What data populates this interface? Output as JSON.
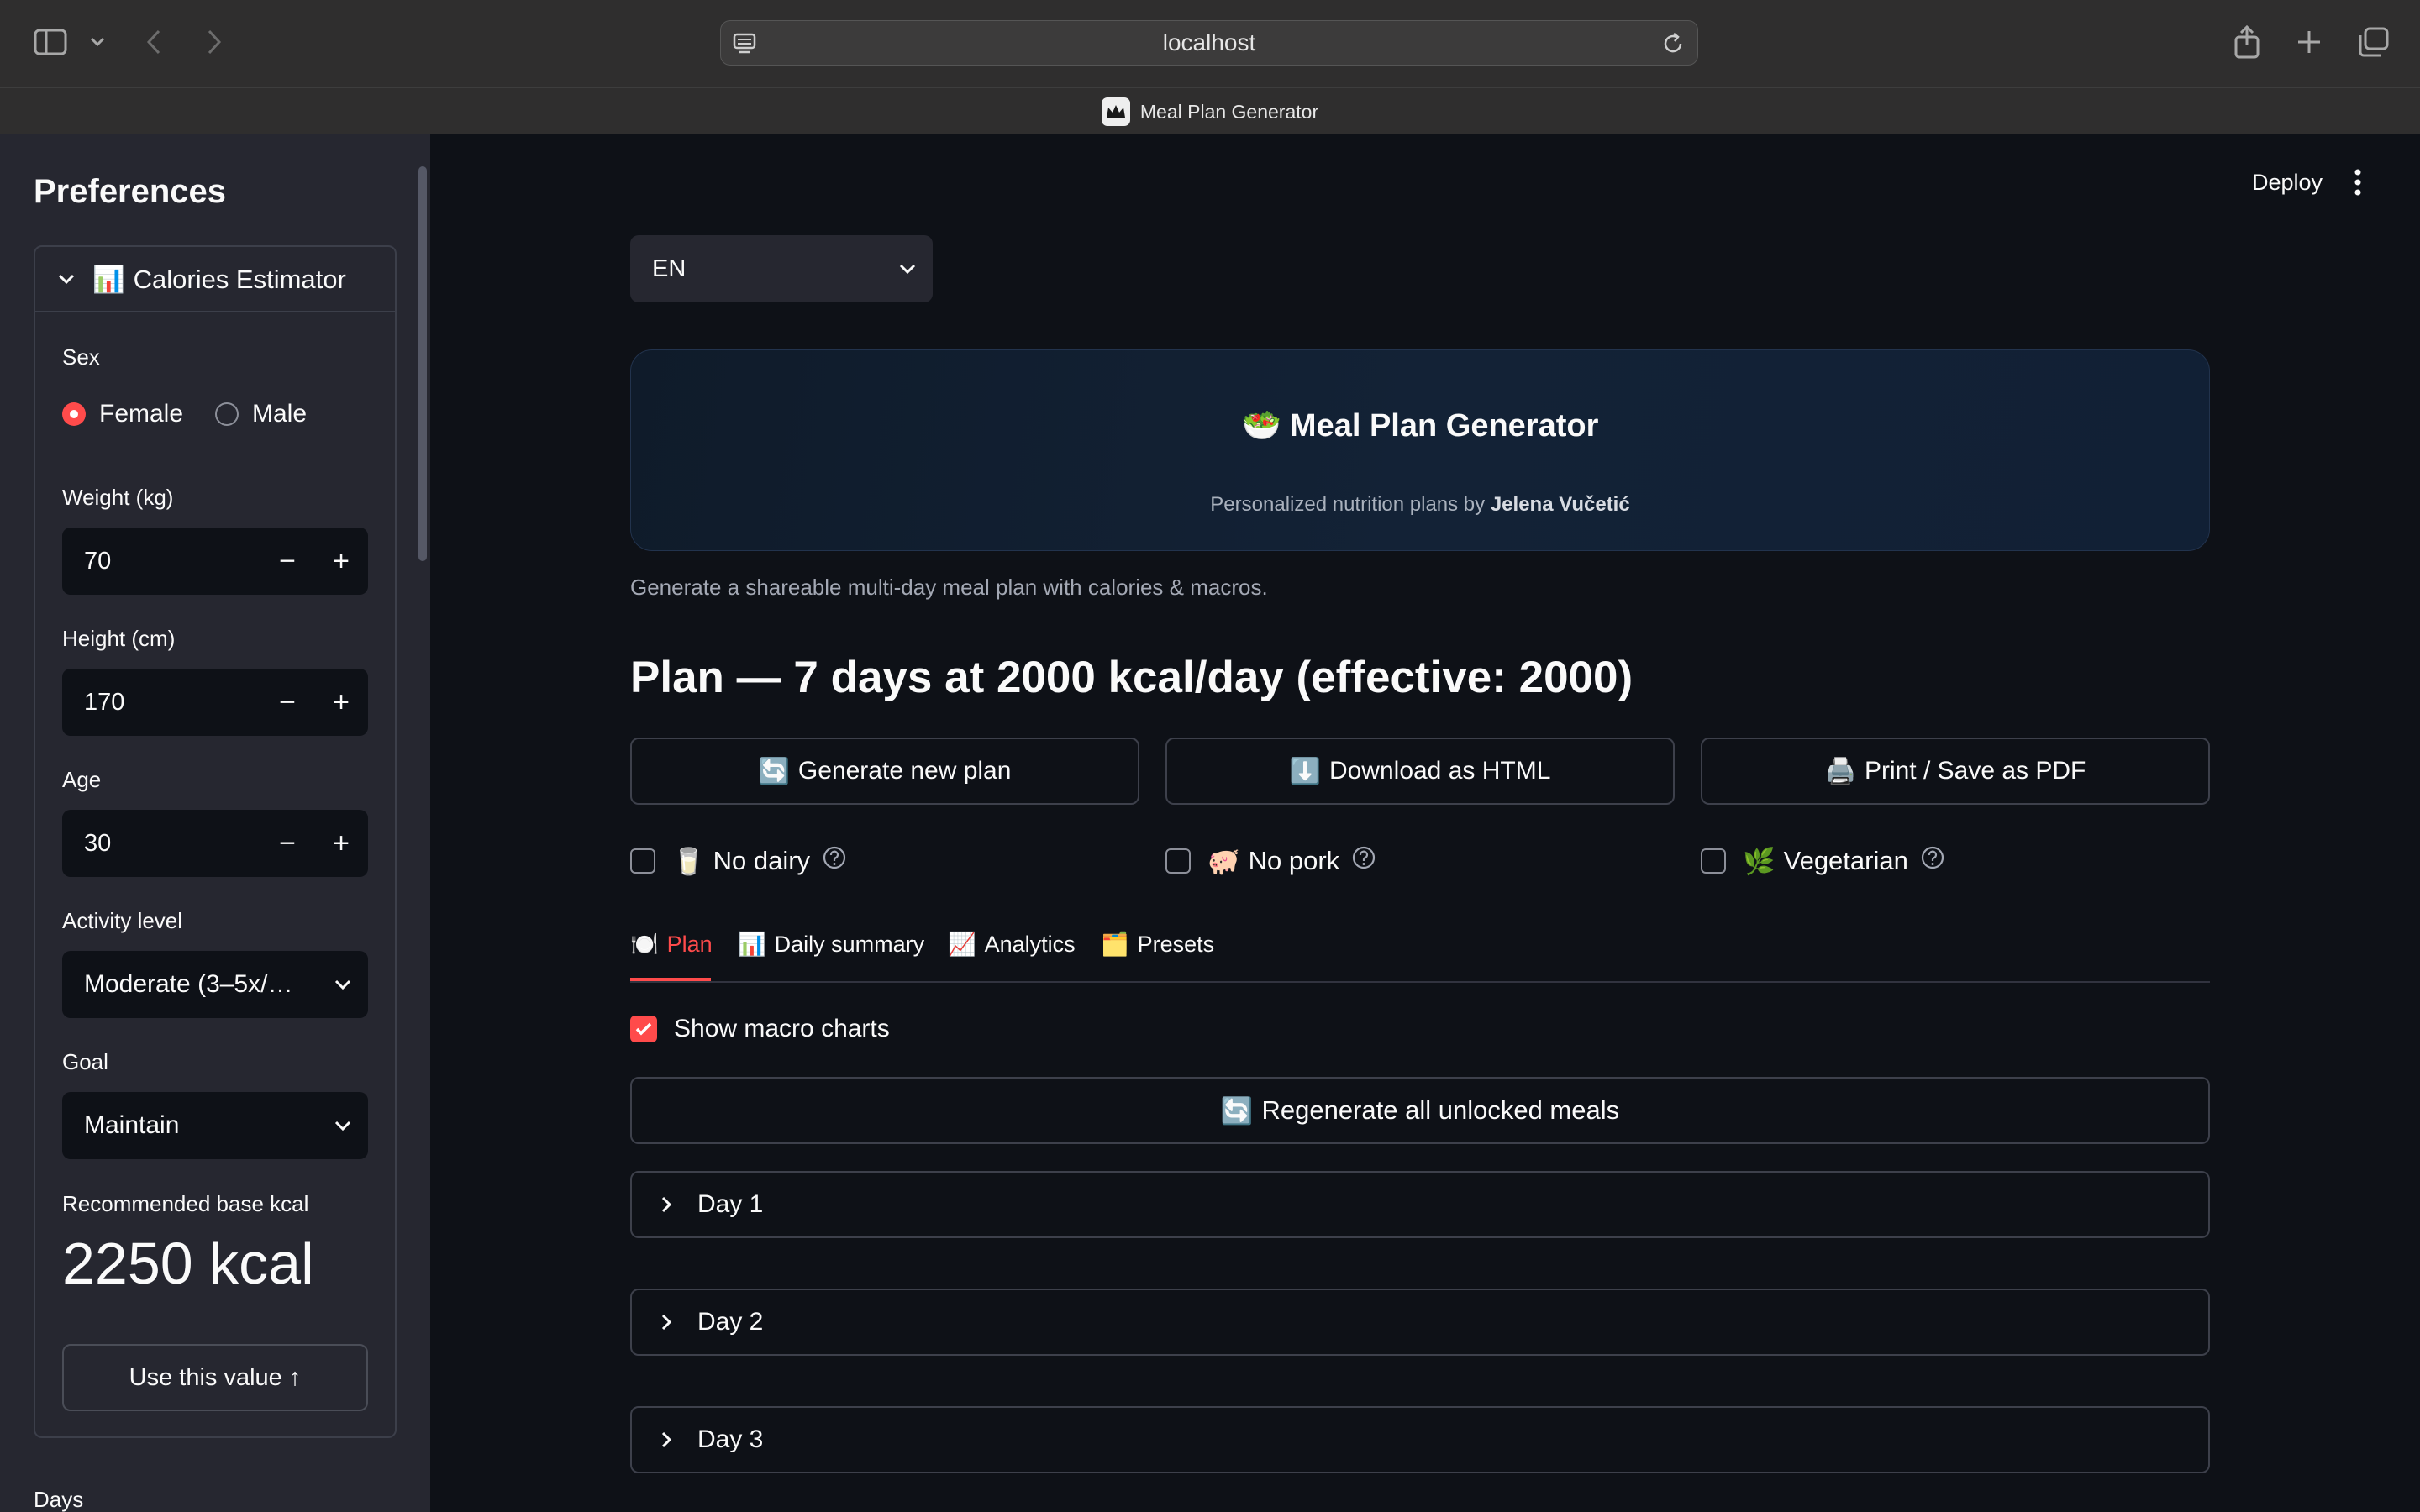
{
  "browser": {
    "url": "localhost",
    "tab_title": "Meal Plan Generator"
  },
  "sidebar": {
    "heading": "Preferences",
    "expander_label": "Calories Estimator",
    "expander_emoji": "📊",
    "sex_label": "Sex",
    "sex_options": [
      "Female",
      "Male"
    ],
    "sex_selected": "Female",
    "weight_label": "Weight (kg)",
    "weight_value": "70",
    "height_label": "Height (cm)",
    "height_value": "170",
    "age_label": "Age",
    "age_value": "30",
    "activity_label": "Activity level",
    "activity_value": "Moderate (3–5x/…",
    "goal_label": "Goal",
    "goal_value": "Maintain",
    "recommended_label": "Recommended base kcal",
    "recommended_value": "2250 kcal",
    "use_button": "Use this value ↑",
    "days_label": "Days"
  },
  "header": {
    "deploy": "Deploy"
  },
  "main": {
    "language": "EN",
    "hero_emoji": "🥗",
    "hero_title": "Meal Plan Generator",
    "hero_sub_prefix": "Personalized nutrition plans by ",
    "hero_author": "Jelena Vučetić",
    "caption": "Generate a shareable multi-day meal plan with calories & macros.",
    "plan_title": "Plan — 7 days at 2000 kcal/day (effective: 2000)",
    "buttons": [
      {
        "emoji": "🔄",
        "label": "Generate new plan"
      },
      {
        "emoji": "⬇️",
        "label": "Download as HTML"
      },
      {
        "emoji": "🖨️",
        "label": "Print / Save as PDF"
      }
    ],
    "filters": [
      {
        "emoji": "🥛",
        "label": "No dairy"
      },
      {
        "emoji": "🐖",
        "label": "No pork"
      },
      {
        "emoji": "🌿",
        "label": "Vegetarian"
      }
    ],
    "tabs": [
      {
        "emoji": "🍽️",
        "label": "Plan"
      },
      {
        "emoji": "📊",
        "label": "Daily summary"
      },
      {
        "emoji": "📈",
        "label": "Analytics"
      },
      {
        "emoji": "🗂️",
        "label": "Presets"
      }
    ],
    "active_tab": "Plan",
    "show_macro_label": "Show macro charts",
    "regen_emoji": "🔄",
    "regen_label": "Regenerate all unlocked meals",
    "days": [
      "Day 1",
      "Day 2",
      "Day 3"
    ]
  },
  "colors": {
    "accent": "#ff4b4b",
    "background": "#0e1117",
    "sidebar": "#262730"
  }
}
